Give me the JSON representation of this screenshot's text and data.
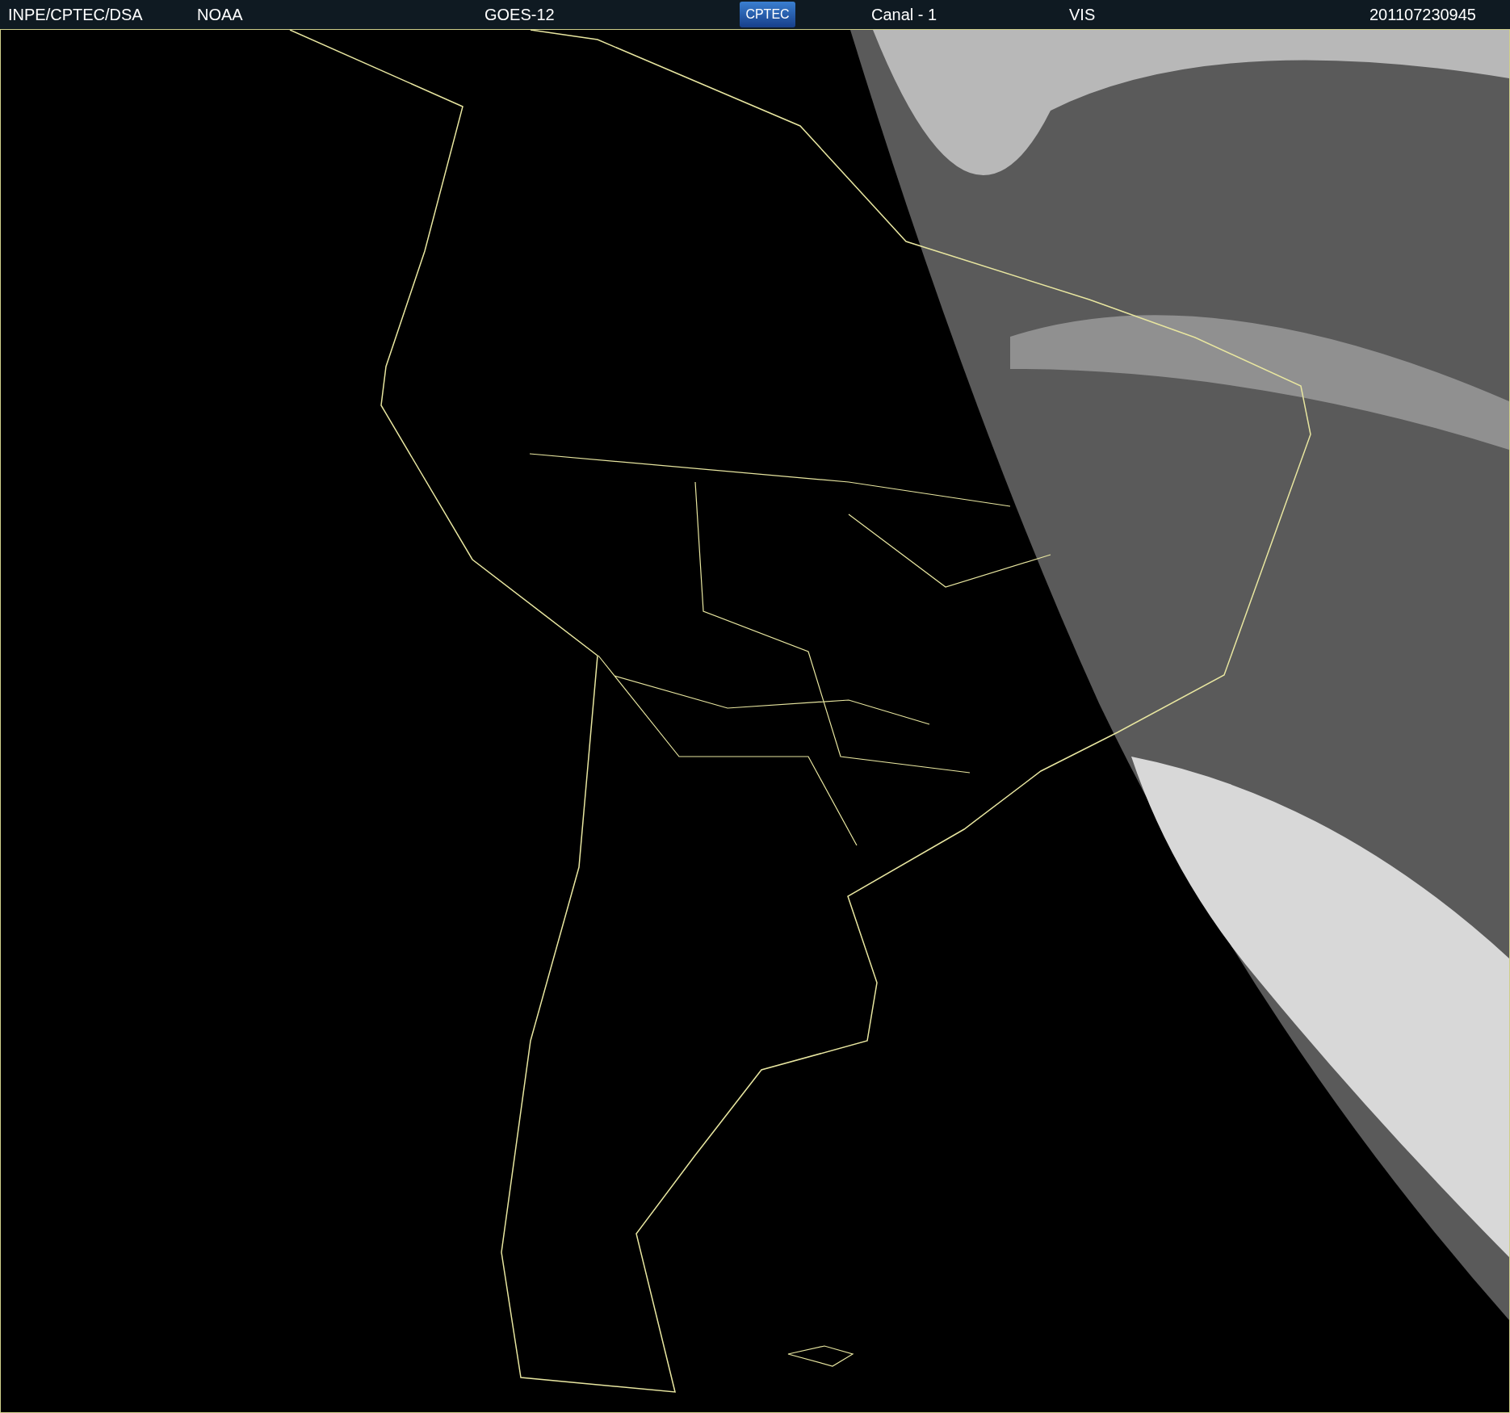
{
  "header": {
    "source": "INPE/CPTEC/DSA",
    "agency": "NOAA",
    "satellite": "GOES-12",
    "logo": "CPTEC",
    "channel": "Canal - 1",
    "band": "VIS",
    "timestamp": "201107230945"
  }
}
